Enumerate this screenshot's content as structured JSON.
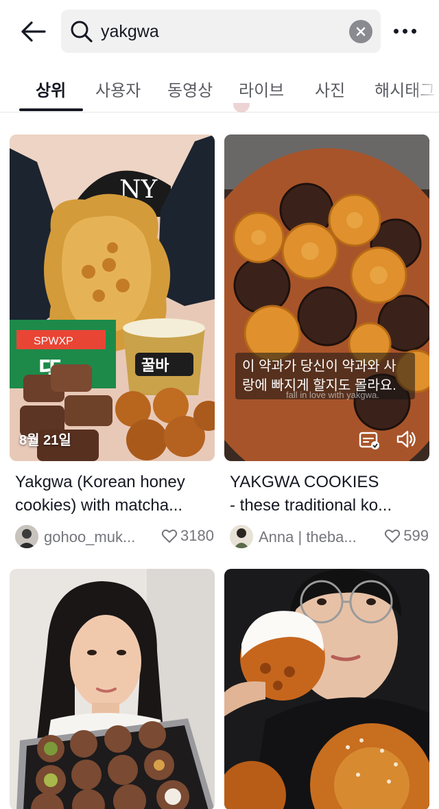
{
  "search": {
    "query": "yakgwa"
  },
  "tabs": [
    {
      "label": "상위"
    },
    {
      "label": "사용자"
    },
    {
      "label": "동영상"
    },
    {
      "label": "라이브"
    },
    {
      "label": "사진"
    },
    {
      "label": "해시태그"
    }
  ],
  "results": [
    {
      "title_line1": "Yakgwa (Korean honey",
      "title_line2": "cookies) with matcha...",
      "username": "gohoo_muk...",
      "likes": "3180",
      "date": "8월 21일",
      "thumb_text_1": "SPWXP",
      "thumb_text_2": "또",
      "thumb_text_3": "꿀바",
      "thumb_text_4": "NY"
    },
    {
      "title_line1": "YAKGWA COOKIES",
      "title_line2": "- these traditional ko...",
      "username": "Anna | theba...",
      "likes": "599",
      "caption": "이 약과가 당신이 약과와 사랑에 빠지게 할지도 몰라요.",
      "caption_sub": "fall in love with yakgwa."
    },
    {
      "title_line1": "",
      "title_line2": "",
      "username": "",
      "likes": ""
    },
    {
      "title_line1": "",
      "title_line2": "",
      "username": "",
      "likes": ""
    }
  ],
  "colors": {
    "text": "#161823",
    "muted": "#75767c",
    "search_bg": "#f1f1f2"
  },
  "icons": {
    "back": "arrow-left",
    "search": "magnifier",
    "clear": "x-circle",
    "more": "ellipsis",
    "heart": "heart-outline",
    "caption_toggle": "caption-icon",
    "volume": "speaker-icon"
  }
}
